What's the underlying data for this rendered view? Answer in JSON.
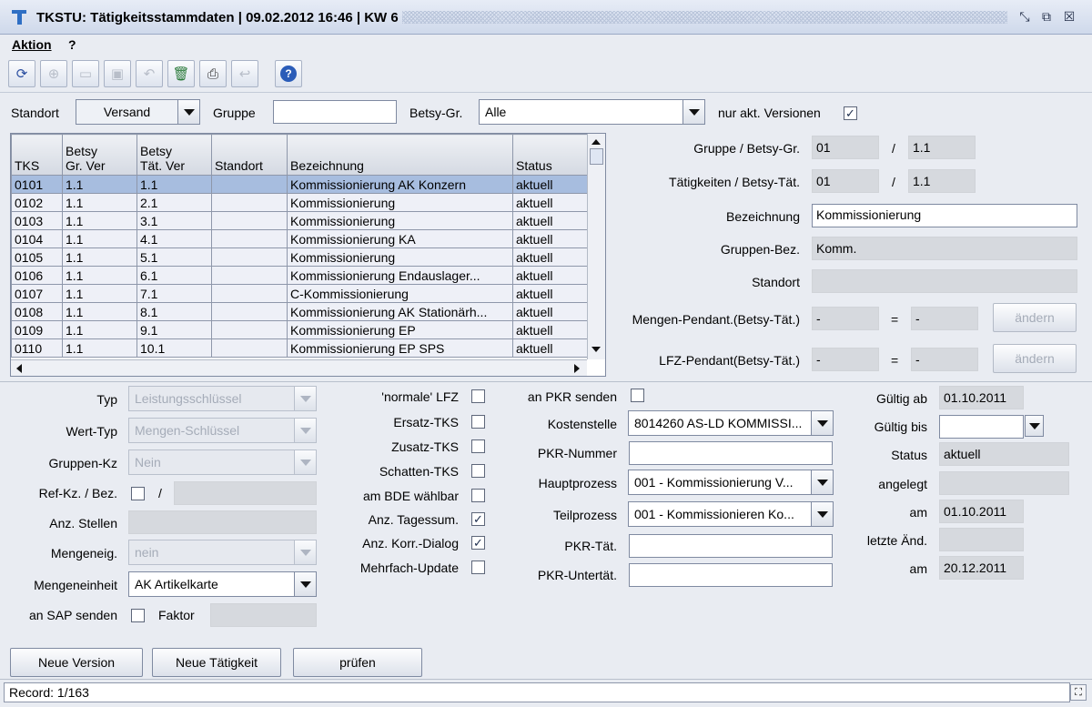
{
  "window": {
    "title": "TKSTU: Tätigkeitsstammdaten | 09.02.2012 16:46 | KW 6"
  },
  "menu": [
    "Aktion",
    "?"
  ],
  "toolbar_icons": [
    "refresh-icon",
    "zoom-icon",
    "new-document-icon",
    "save-icon",
    "undo-icon",
    "delete-icon",
    "print-icon",
    "reply-icon",
    "help-icon"
  ],
  "filter": {
    "standort_label": "Standort",
    "standort_value": "Versand",
    "gruppe_label": "Gruppe",
    "gruppe_value": "",
    "betsy_gr_label": "Betsy-Gr.",
    "betsy_gr_value": "Alle",
    "versions_label": "nur akt. Versionen",
    "versions_checked": "✓"
  },
  "table": {
    "headers": [
      "TKS",
      "Betsy\nGr. Ver",
      "Betsy\nTät. Ver",
      "Standort",
      "Bezeichnung",
      "Status"
    ],
    "rows": [
      [
        "0101",
        "1.1",
        "1.1",
        "",
        "Kommissionierung AK Konzern",
        "aktuell"
      ],
      [
        "0102",
        "1.1",
        "2.1",
        "",
        "Kommissionierung",
        "aktuell"
      ],
      [
        "0103",
        "1.1",
        "3.1",
        "",
        "Kommissionierung",
        "aktuell"
      ],
      [
        "0104",
        "1.1",
        "4.1",
        "",
        "Kommissionierung KA",
        "aktuell"
      ],
      [
        "0105",
        "1.1",
        "5.1",
        "",
        "Kommissionierung",
        "aktuell"
      ],
      [
        "0106",
        "1.1",
        "6.1",
        "",
        "Kommissionierung Endauslager...",
        "aktuell"
      ],
      [
        "0107",
        "1.1",
        "7.1",
        "",
        "C-Kommissionierung",
        "aktuell"
      ],
      [
        "0108",
        "1.1",
        "8.1",
        "",
        "Kommissionierung AK Stationärh...",
        "aktuell"
      ],
      [
        "0109",
        "1.1",
        "9.1",
        "",
        "Kommissionierung EP",
        "aktuell"
      ],
      [
        "0110",
        "1.1",
        "10.1",
        "",
        "Kommissionierung EP SPS",
        "aktuell"
      ]
    ]
  },
  "detail_top": {
    "gruppe_label": "Gruppe / Betsy-Gr.",
    "gruppe_value": "01",
    "betsy_gr_value": "1.1",
    "taet_label": "Tätigkeiten / Betsy-Tät.",
    "taet_value": "01",
    "betsy_taet_value": "1.1",
    "slash": "/",
    "bezeichnung_label": "Bezeichnung",
    "bezeichnung_value": "Kommissionierung",
    "gruppen_bez_label": "Gruppen-Bez.",
    "gruppen_bez_value": "Komm.",
    "standort_label": "Standort",
    "standort_value": "",
    "mengen_label": "Mengen-Pendant.(Betsy-Tät.)",
    "mengen_a": "-",
    "mengen_b": "-",
    "lfz_label": "LFZ-Pendant(Betsy-Tät.)",
    "lfz_a": "-",
    "lfz_b": "-",
    "equals": "=",
    "aendern_label": "ändern"
  },
  "detail_left": {
    "typ_label": "Typ",
    "typ_value": "Leistungsschlüssel",
    "werttyp_label": "Wert-Typ",
    "werttyp_value": "Mengen-Schlüssel",
    "gruppenkz_label": "Gruppen-Kz",
    "gruppenkz_value": "Nein",
    "refkz_label": "Ref-Kz. / Bez.",
    "slash": "/",
    "anzstellen_label": "Anz. Stellen",
    "mengeneig_label": "Mengeneig.",
    "mengeneig_value": "nein",
    "mengeneinheit_label": "Mengeneinheit",
    "mengeneinheit_value": "AK Artikelkarte",
    "sap_label": "an SAP senden",
    "faktor_label": "Faktor"
  },
  "detail_checks": {
    "normale_lfz": "'normale' LFZ",
    "ersatz_tks": "Ersatz-TKS",
    "zusatz_tks": "Zusatz-TKS",
    "schatten_tks": "Schatten-TKS",
    "bde": "am BDE wählbar",
    "tagessum": "Anz. Tagessum.",
    "korr_dialog": "Anz. Korr.-Dialog",
    "mehrfach": "Mehrfach-Update",
    "check_mark": "✓"
  },
  "detail_pkr": {
    "pkr_senden_label": "an PKR senden",
    "kostenstelle_label": "Kostenstelle",
    "kostenstelle_value": "8014260 AS-LD KOMMISSI...",
    "pkr_nummer_label": "PKR-Nummer",
    "hauptprozess_label": "Hauptprozess",
    "hauptprozess_value": "001 - Kommissionierung V...",
    "teilprozess_label": "Teilprozess",
    "teilprozess_value": "001 - Kommissionieren Ko...",
    "pkr_taet_label": "PKR-Tät.",
    "pkr_untertaet_label": "PKR-Untertät."
  },
  "detail_right": {
    "gueltig_ab_label": "Gültig ab",
    "gueltig_ab_value": "01.10.2011",
    "gueltig_bis_label": "Gültig bis",
    "status_label": "Status",
    "status_value": "aktuell",
    "angelegt_label": "angelegt",
    "am_label": "am",
    "am_value": "01.10.2011",
    "letzte_label": "letzte Änd.",
    "am2_value": "20.12.2011"
  },
  "buttons": {
    "neue_version": "Neue Version",
    "neue_taetigkeit": "Neue Tätigkeit",
    "pruefen": "prüfen"
  },
  "status": {
    "record": "Record: 1/163"
  }
}
